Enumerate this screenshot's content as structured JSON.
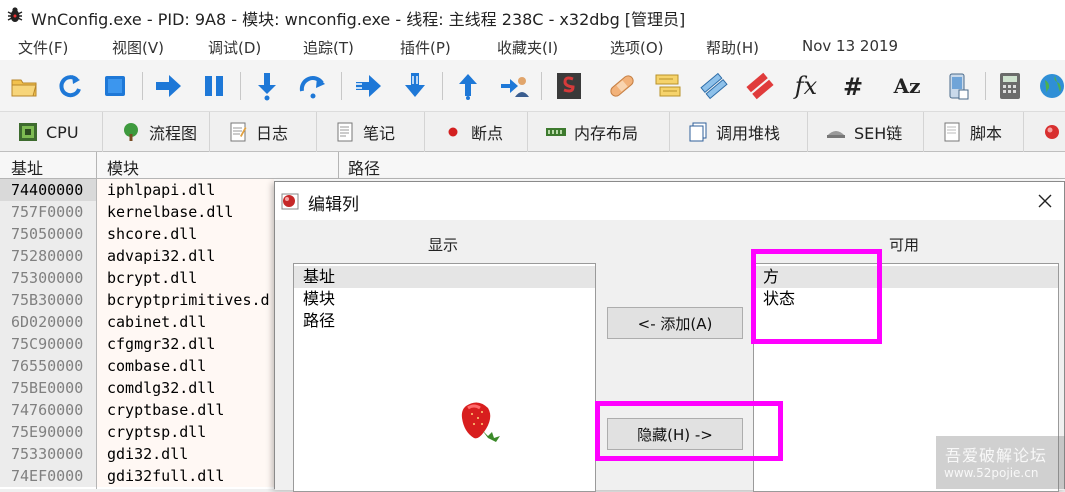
{
  "window": {
    "title": "WnConfig.exe - PID: 9A8 - 模块: wnconfig.exe - 线程: 主线程 238C - x32dbg [管理员]"
  },
  "menu": [
    "文件(F)",
    "视图(V)",
    "调试(D)",
    "追踪(T)",
    "插件(P)",
    "收藏夹(I)",
    "选项(O)",
    "帮助(H)",
    "Nov 13 2019"
  ],
  "toolbar": {
    "fx_label": "fx",
    "hash_label": "#",
    "az_label": "Az"
  },
  "tabs": [
    {
      "label": "CPU",
      "icon": "cpu-icon"
    },
    {
      "label": "流程图",
      "icon": "tree-icon"
    },
    {
      "label": "日志",
      "icon": "log-icon"
    },
    {
      "label": "笔记",
      "icon": "notes-icon"
    },
    {
      "label": "断点",
      "icon": "breakpoint-icon"
    },
    {
      "label": "内存布局",
      "icon": "memory-icon"
    },
    {
      "label": "调用堆栈",
      "icon": "callstack-icon"
    },
    {
      "label": "SEH链",
      "icon": "seh-icon"
    },
    {
      "label": "脚本",
      "icon": "script-icon"
    }
  ],
  "table": {
    "headers": [
      "基址",
      "模块",
      "路径"
    ],
    "rows": [
      {
        "addr": "74400000",
        "name": "iphlpapi.dll"
      },
      {
        "addr": "757F0000",
        "name": "kernelbase.dll"
      },
      {
        "addr": "75050000",
        "name": "shcore.dll"
      },
      {
        "addr": "75280000",
        "name": "advapi32.dll"
      },
      {
        "addr": "75300000",
        "name": "bcrypt.dll"
      },
      {
        "addr": "75B30000",
        "name": "bcryptprimitives.d"
      },
      {
        "addr": "6D020000",
        "name": "cabinet.dll"
      },
      {
        "addr": "75C90000",
        "name": "cfgmgr32.dll"
      },
      {
        "addr": "76550000",
        "name": "combase.dll"
      },
      {
        "addr": "75BE0000",
        "name": "comdlg32.dll"
      },
      {
        "addr": "74760000",
        "name": "cryptbase.dll"
      },
      {
        "addr": "75E90000",
        "name": "cryptsp.dll"
      },
      {
        "addr": "75330000",
        "name": "gdi32.dll"
      },
      {
        "addr": "74EF0000",
        "name": "gdi32full.dll"
      }
    ]
  },
  "dialog": {
    "title": "编辑列",
    "shown_label": "显示",
    "available_label": "可用",
    "shown_items": [
      "基址",
      "模块",
      "路径"
    ],
    "available_items": [
      "方",
      "状态"
    ],
    "add_button": "<- 添加(A)",
    "hide_button": "隐藏(H) ->"
  },
  "watermark": {
    "line1": "吾爱破解论坛",
    "line2": "www.52pojie.cn"
  },
  "colors": {
    "highlight": "#ff00ff",
    "accent_blue": "#1e78d7"
  }
}
